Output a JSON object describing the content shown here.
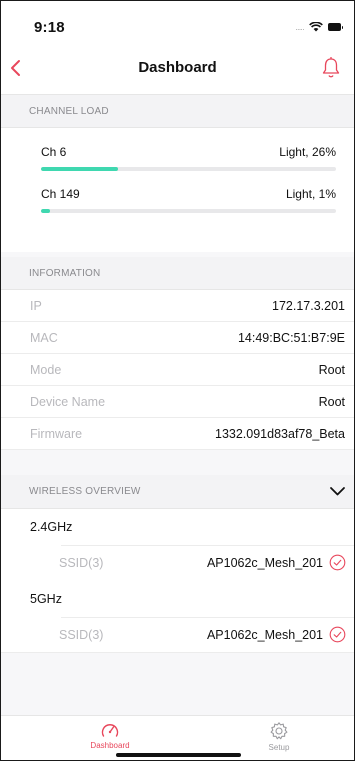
{
  "status": {
    "time": "9:18",
    "dots": "....."
  },
  "header": {
    "title": "Dashboard"
  },
  "channel_load": {
    "heading": "CHANNEL LOAD",
    "channels": [
      {
        "name": "Ch 6",
        "status": "Light, 26%",
        "load_percent": 26
      },
      {
        "name": "Ch 149",
        "status": "Light, 1%",
        "load_percent": 1
      }
    ]
  },
  "information": {
    "heading": "INFORMATION",
    "rows": [
      {
        "key": "IP",
        "value": "172.17.3.201"
      },
      {
        "key": "MAC",
        "value": "14:49:BC:51:B7:9E"
      },
      {
        "key": "Mode",
        "value": "Root"
      },
      {
        "key": "Device Name",
        "value": "Root"
      },
      {
        "key": "Firmware",
        "value": "1332.091d83af78_Beta"
      }
    ]
  },
  "wireless_overview": {
    "heading": "WIRELESS OVERVIEW",
    "bands": [
      {
        "band": "2.4GHz",
        "ssid_label": "SSID(3)",
        "ssid_value": "AP1062c_Mesh_201"
      },
      {
        "band": "5GHz",
        "ssid_label": "SSID(3)",
        "ssid_value": "AP1062c_Mesh_201"
      }
    ]
  },
  "tabs": [
    {
      "label": "Dashboard",
      "icon": "speedometer-icon",
      "active": true
    },
    {
      "label": "Setup",
      "icon": "gear-icon",
      "active": false
    }
  ],
  "colors": {
    "accent": "#e8475c",
    "load_bar": "#3fd8b0"
  }
}
